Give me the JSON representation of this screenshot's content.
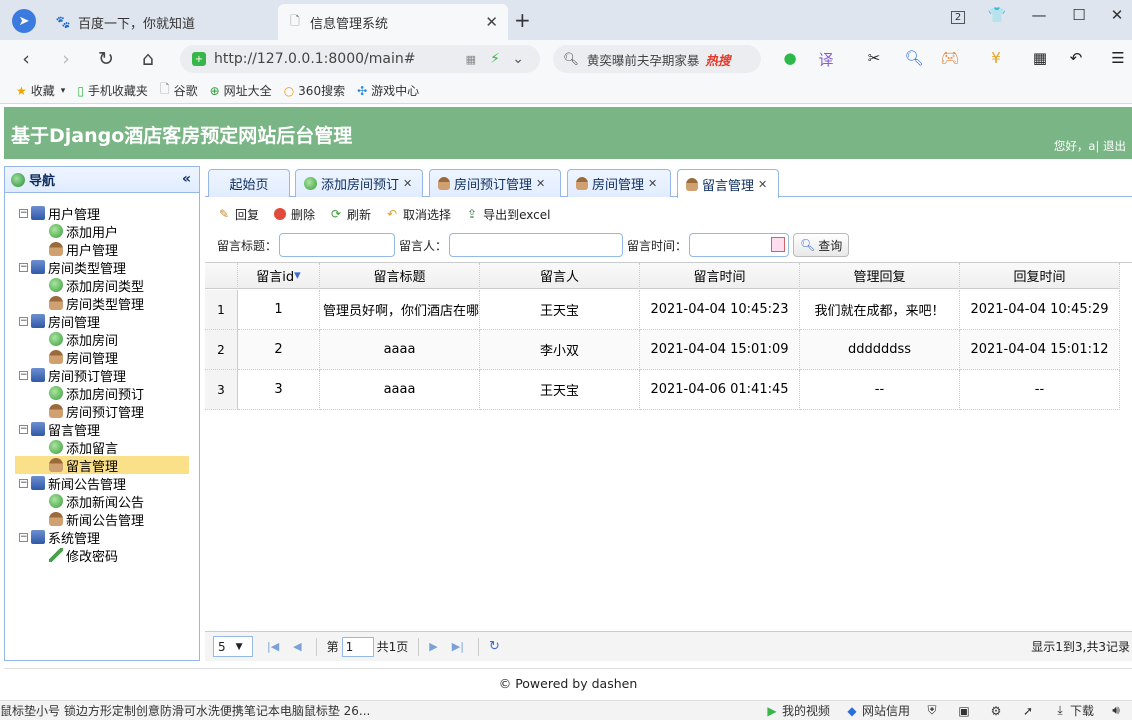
{
  "browser": {
    "tabs": [
      {
        "label": "百度一下，你就知道",
        "icon": "paw-icon"
      },
      {
        "label": "信息管理系统",
        "icon": "page-icon"
      }
    ],
    "url": "http://127.0.0.1:8000/main#",
    "search_text": "黄奕曝前夫孕期家暴",
    "search_hot": "热搜",
    "bookmarks": [
      "收藏",
      "手机收藏夹",
      "谷歌",
      "网址大全",
      "360搜索",
      "游戏中心"
    ]
  },
  "app": {
    "title": "基于Django酒店客房预定网站后台管理",
    "greeting": "您好，a| 退出"
  },
  "nav": {
    "header": "导航",
    "tree": [
      {
        "label": "用户管理",
        "level": 0,
        "icon": "computer-icon"
      },
      {
        "label": "添加用户",
        "level": 1,
        "icon": "add-icon"
      },
      {
        "label": "用户管理",
        "level": 1,
        "icon": "user-icon"
      },
      {
        "label": "房间类型管理",
        "level": 0,
        "icon": "computer-icon"
      },
      {
        "label": "添加房间类型",
        "level": 1,
        "icon": "add-icon"
      },
      {
        "label": "房间类型管理",
        "level": 1,
        "icon": "user-icon"
      },
      {
        "label": "房间管理",
        "level": 0,
        "icon": "computer-icon"
      },
      {
        "label": "添加房间",
        "level": 1,
        "icon": "add-icon"
      },
      {
        "label": "房间管理",
        "level": 1,
        "icon": "user-icon"
      },
      {
        "label": "房间预订管理",
        "level": 0,
        "icon": "computer-icon"
      },
      {
        "label": "添加房间预订",
        "level": 1,
        "icon": "add-icon"
      },
      {
        "label": "房间预订管理",
        "level": 1,
        "icon": "user-icon"
      },
      {
        "label": "留言管理",
        "level": 0,
        "icon": "computer-icon"
      },
      {
        "label": "添加留言",
        "level": 1,
        "icon": "add-icon"
      },
      {
        "label": "留言管理",
        "level": 1,
        "icon": "user-icon",
        "selected": true
      },
      {
        "label": "新闻公告管理",
        "level": 0,
        "icon": "computer-icon"
      },
      {
        "label": "添加新闻公告",
        "level": 1,
        "icon": "add-icon"
      },
      {
        "label": "新闻公告管理",
        "level": 1,
        "icon": "user-icon"
      },
      {
        "label": "系统管理",
        "level": 0,
        "icon": "computer-icon"
      },
      {
        "label": "修改密码",
        "level": 1,
        "icon": "pencil-icon"
      }
    ]
  },
  "tabs": [
    {
      "label": "起始页",
      "closable": false
    },
    {
      "label": "添加房间预订",
      "closable": true
    },
    {
      "label": "房间预订管理",
      "closable": true
    },
    {
      "label": "房间管理",
      "closable": true
    },
    {
      "label": "留言管理",
      "closable": true,
      "active": true
    }
  ],
  "toolbar": {
    "reply": "回复",
    "delete": "删除",
    "refresh": "刷新",
    "unselect": "取消选择",
    "export": "导出到excel"
  },
  "filters": {
    "title_label": "留言标题：",
    "person_label": "留言人：",
    "time_label": "留言时间：",
    "query": "查询"
  },
  "grid": {
    "columns": [
      "留言id",
      "留言标题",
      "留言人",
      "留言时间",
      "管理回复",
      "回复时间"
    ],
    "rows": [
      {
        "n": "1",
        "cells": [
          "1",
          "管理员好啊，你们酒店在哪",
          "王天宝",
          "2021-04-04 10:45:23",
          "我们就在成都，来吧！",
          "2021-04-04 10:45:29"
        ]
      },
      {
        "n": "2",
        "cells": [
          "2",
          "aaaa",
          "李小双",
          "2021-04-04 15:01:09",
          "ddddddss",
          "2021-04-04 15:01:12"
        ]
      },
      {
        "n": "3",
        "cells": [
          "3",
          "aaaa",
          "王天宝",
          "2021-04-06 01:41:45",
          "--",
          "--"
        ]
      }
    ]
  },
  "pager": {
    "page_size": "5",
    "page_prefix": "第",
    "page_value": "1",
    "page_suffix": "共1页",
    "info": "显示1到3,共3记录"
  },
  "footer": "© Powered by dashen",
  "statusbar": {
    "ad": "鼠标垫小号 锁边方形定制创意防滑可水洗便携笔记本电脑鼠标垫 26...",
    "video": "我的视频",
    "credit": "网站信用",
    "download": "下载"
  }
}
